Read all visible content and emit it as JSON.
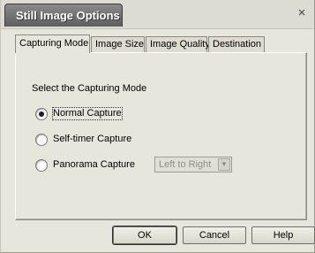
{
  "window": {
    "title": "Still Image Options",
    "close_symbol": "×"
  },
  "tabs": [
    {
      "label": "Capturing Mode",
      "active": true
    },
    {
      "label": "Image Size",
      "active": false
    },
    {
      "label": "Image Quality",
      "active": false
    },
    {
      "label": "Destination",
      "active": false
    }
  ],
  "panel": {
    "group_label": "Select the Capturing Mode",
    "options": [
      {
        "label": "Normal Capture",
        "selected": true
      },
      {
        "label": "Self-timer Capture",
        "selected": false
      },
      {
        "label": "Panorama Capture",
        "selected": false
      }
    ],
    "direction_select": {
      "value": "Left to Right",
      "enabled": false
    }
  },
  "buttons": {
    "ok": "OK",
    "cancel": "Cancel",
    "help": "Help"
  }
}
